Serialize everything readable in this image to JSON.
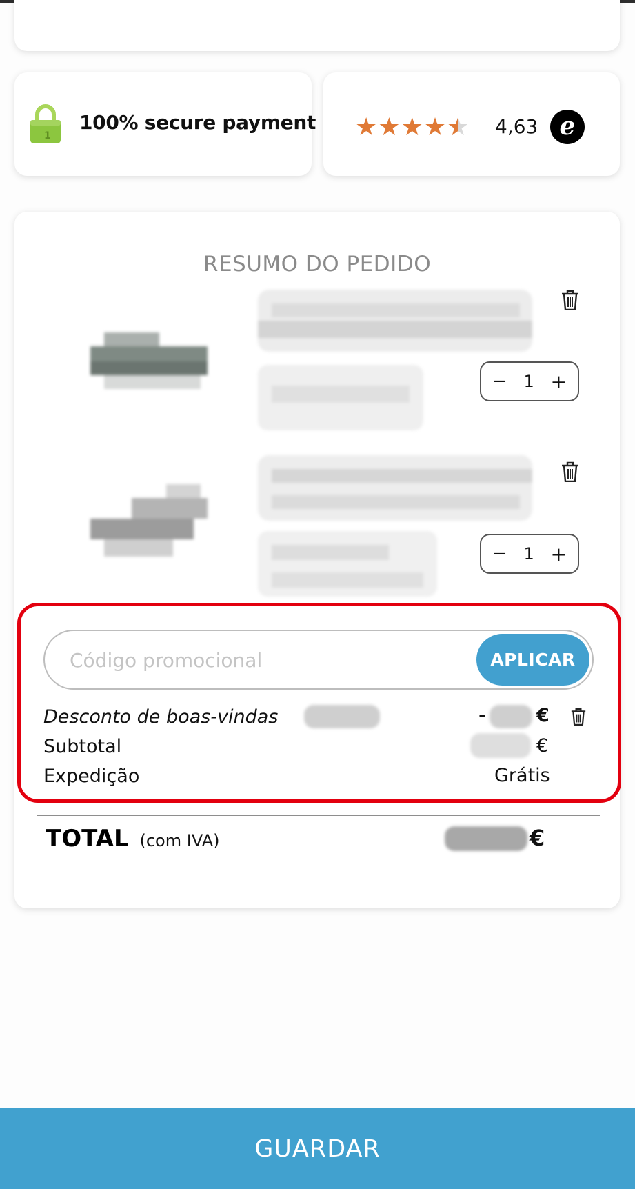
{
  "trust": {
    "secure_label": "100% secure payment",
    "rating_value": "4,63",
    "rating_stars": 4.5,
    "trust_badge_letter": "e"
  },
  "order": {
    "title": "RESUMO DO PEDIDO",
    "items": [
      {
        "quantity": "1",
        "minus": "−",
        "plus": "+"
      },
      {
        "quantity": "1",
        "minus": "−",
        "plus": "+"
      }
    ],
    "promo": {
      "placeholder": "Código promocional",
      "value": "",
      "apply_label": "APLICAR"
    },
    "discount": {
      "label": "Desconto de boas-vindas",
      "prefix": "-",
      "currency": "€"
    },
    "subtotal": {
      "label": "Subtotal",
      "currency": "€"
    },
    "shipping": {
      "label": "Expedição",
      "value": "Grátis"
    },
    "total": {
      "label": "TOTAL",
      "sub_label": "(com IVA)",
      "currency": "€"
    }
  },
  "footer": {
    "save_label": "GUARDAR"
  },
  "colors": {
    "accent": "#42a0cf",
    "highlight": "#e3000f",
    "stars": "#e07a36",
    "lock": "#8cc63f"
  },
  "icons": [
    "lock-icon",
    "star-icon",
    "trusted-shops-badge",
    "trash-icon"
  ]
}
